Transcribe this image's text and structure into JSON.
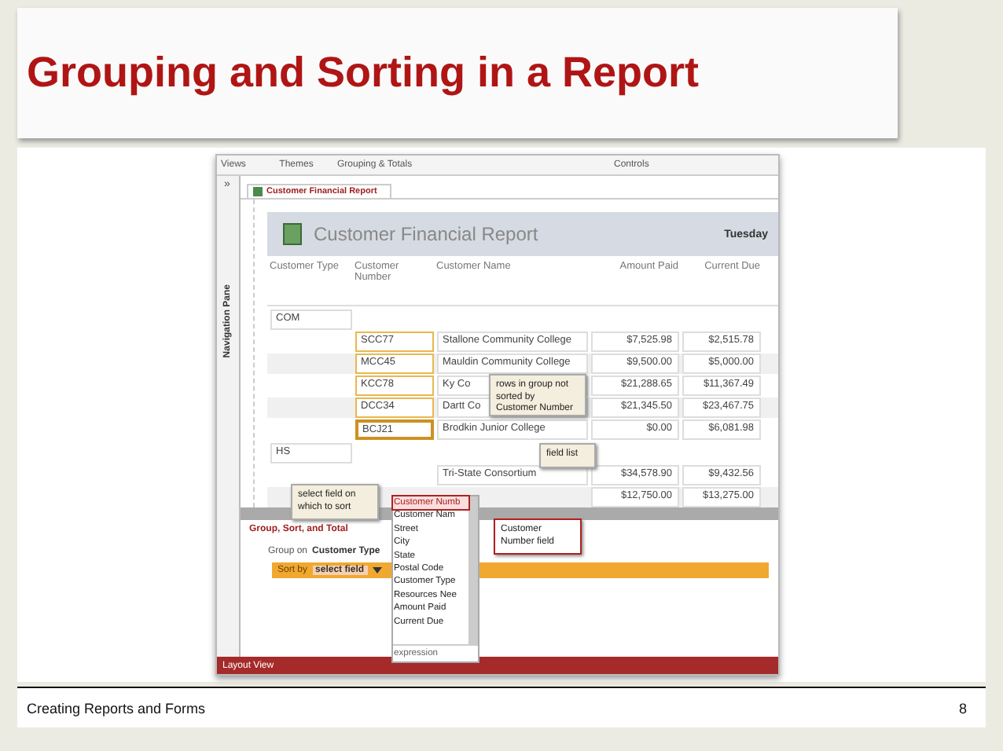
{
  "slide": {
    "title": "Grouping and Sorting in a Report",
    "footer": "Creating Reports and Forms",
    "page_number": "8"
  },
  "screenshot": {
    "ribbon_groups": [
      "Views",
      "Themes",
      "Grouping & Totals",
      "Controls"
    ],
    "nav_toggle": "»",
    "nav_pane": "Navigation Pane",
    "tab": {
      "label": "Customer Financial Report",
      "selected": true
    },
    "report": {
      "title": "Customer Financial Report",
      "date": "Tuesday",
      "columns": [
        "Customer Type",
        "Customer Number",
        "Customer Name",
        "Amount Paid",
        "Current Due"
      ],
      "groups": [
        {
          "type": "COM",
          "rows": [
            {
              "number": "SCC77",
              "name": "Stallone Community College",
              "paid": "$7,525.98",
              "due": "$2,515.78",
              "selected": false
            },
            {
              "number": "MCC45",
              "name": "Mauldin Community College",
              "paid": "$9,500.00",
              "due": "$5,000.00",
              "selected": false
            },
            {
              "number": "KCC78",
              "name": "Ky Co",
              "paid": "$21,288.65",
              "due": "$11,367.49",
              "selected": false
            },
            {
              "number": "DCC34",
              "name": "Dartt Co",
              "paid": "$21,345.50",
              "due": "$23,467.75",
              "selected": false
            },
            {
              "number": "BCJ21",
              "name": "Brodkin Junior College",
              "paid": "$0.00",
              "due": "$6,081.98",
              "selected": true
            }
          ]
        },
        {
          "type": "HS",
          "rows": [
            {
              "name": "Tri-State Consortium",
              "paid": "$34,578.90",
              "due": "$9,432.56"
            },
            {
              "paid": "$12,750.00",
              "due": "$13,275.00"
            }
          ]
        }
      ]
    },
    "group_pane": {
      "title": "Group, Sort, and Total",
      "group_label": "Group on",
      "group_field": "Customer Type",
      "sort_label": "Sort by",
      "sort_field": "select field"
    },
    "field_list": {
      "items": [
        {
          "label": "Customer Numb",
          "selected": true
        },
        {
          "label": "Customer Nam",
          "selected": false
        },
        {
          "label": "Street",
          "selected": false
        },
        {
          "label": "City",
          "selected": false
        },
        {
          "label": "State",
          "selected": false
        },
        {
          "label": "Postal Code",
          "selected": false
        },
        {
          "label": "Customer Type",
          "selected": false
        },
        {
          "label": "Resources Nee",
          "selected": false
        },
        {
          "label": "Amount Paid",
          "selected": false
        },
        {
          "label": "Current Due",
          "selected": false
        }
      ],
      "footer": "expression"
    },
    "status_bar": "Layout View",
    "callouts": [
      {
        "text": "rows in group not sorted by Customer Number",
        "kind": "note"
      },
      {
        "text": "field list",
        "kind": "note"
      },
      {
        "text": "select field on which to sort",
        "kind": "note"
      },
      {
        "text": "Customer Number field",
        "kind": "highlight"
      }
    ]
  }
}
